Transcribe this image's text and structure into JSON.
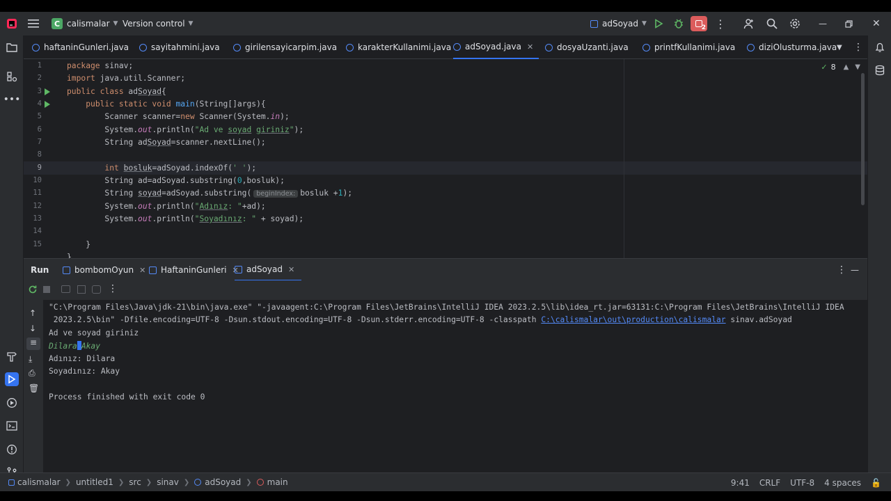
{
  "titlebar": {
    "project_initial": "C",
    "project_name": "calismalar",
    "vcs_label": "Version control",
    "run_config": "adSoyad",
    "notif_count": "2"
  },
  "tabs": [
    {
      "label": "haftaninGunleri.java"
    },
    {
      "label": "sayitahmini.java"
    },
    {
      "label": "girilensayicarpim.java"
    },
    {
      "label": "karakterKullanimi.java"
    },
    {
      "label": "adSoyad.java"
    },
    {
      "label": "dosyaUzanti.java"
    },
    {
      "label": "printfKullanimi.java"
    },
    {
      "label": "diziOlusturma.java"
    }
  ],
  "editor": {
    "warnings_count": "8",
    "line_numbers": [
      "1",
      "2",
      "3",
      "4",
      "5",
      "6",
      "7",
      "8",
      "9",
      "10",
      "11",
      "12",
      "13",
      "14",
      "15"
    ],
    "param_hint": "beginIndex:"
  },
  "run_panel": {
    "title": "Run",
    "tabs": [
      {
        "label": "bombomOyun"
      },
      {
        "label": "HaftaninGunleri"
      },
      {
        "label": "adSoyad"
      }
    ]
  },
  "console": {
    "cmd_line1": "\"C:\\Program Files\\Java\\jdk-21\\bin\\java.exe\" \"-javaagent:C:\\Program Files\\JetBrains\\IntelliJ IDEA 2023.2.5\\lib\\idea_rt.jar=63131:C:\\Program Files\\JetBrains\\IntelliJ IDEA",
    "cmd_line2_pre": " 2023.2.5\\bin\" -Dfile.encoding=UTF-8 -Dsun.stdout.encoding=UTF-8 -Dsun.stderr.encoding=UTF-8 -classpath ",
    "cmd_line2_link": "C:\\calismalar\\out\\production\\calismalar",
    "cmd_line2_post": " sinav.adSoyad",
    "prompt": "Ad ve soyad giriniz",
    "input_first": "Dilara",
    "input_last": "Akay",
    "out_name": "Adınız: Dilara",
    "out_surname": "Soyadınız: Akay",
    "exit": "Process finished with exit code 0"
  },
  "statusbar": {
    "breadcrumbs": [
      "calismalar",
      "untitled1",
      "src",
      "sinav",
      "adSoyad",
      "main"
    ],
    "position": "9:41",
    "line_sep": "CRLF",
    "encoding": "UTF-8",
    "indent": "4 spaces"
  }
}
